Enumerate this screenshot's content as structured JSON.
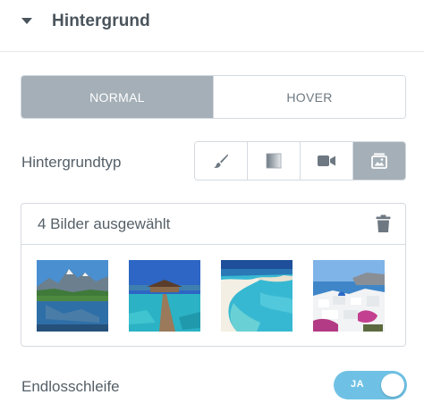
{
  "section": {
    "title": "Hintergrund"
  },
  "tabs": [
    {
      "label": "NORMAL",
      "active": true
    },
    {
      "label": "HOVER",
      "active": false
    }
  ],
  "background_type": {
    "label": "Hintergrundtyp",
    "options": [
      {
        "icon": "paint-brush-icon",
        "active": false
      },
      {
        "icon": "gradient-icon",
        "active": false
      },
      {
        "icon": "video-camera-icon",
        "active": false
      },
      {
        "icon": "slideshow-icon",
        "active": true
      }
    ]
  },
  "gallery": {
    "count_label": "4 Bilder ausgewählt",
    "images": [
      {
        "subject": "mountain-lake"
      },
      {
        "subject": "overwater-bungalow-pier"
      },
      {
        "subject": "tropical-beach-aerial"
      },
      {
        "subject": "santorini-village"
      }
    ]
  },
  "loop": {
    "label": "Endlosschleife",
    "toggle_label": "JA",
    "enabled": true
  },
  "colors": {
    "active_tab": "#a4afb7",
    "toggle_on": "#6ec1e4",
    "border": "#d5dadf",
    "text": "#556068"
  }
}
